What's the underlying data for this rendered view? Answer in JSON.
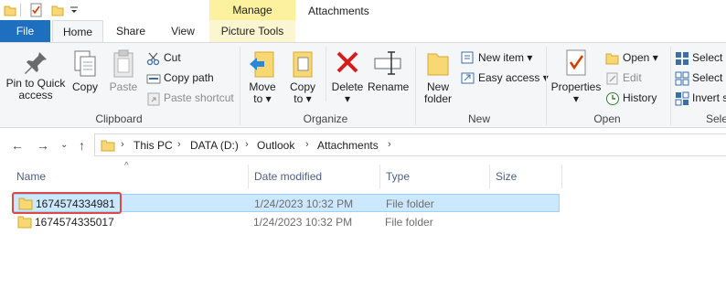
{
  "window": {
    "title": "Attachments",
    "context_tab": "Manage"
  },
  "tabs": [
    {
      "label": "File"
    },
    {
      "label": "Home"
    },
    {
      "label": "Share"
    },
    {
      "label": "View"
    },
    {
      "label": "Picture Tools"
    }
  ],
  "ribbon": {
    "clipboard": {
      "label": "Clipboard",
      "pin": "Pin to Quick\naccess",
      "pin_line1": "Pin to Quick",
      "pin_line2": "access",
      "copy": "Copy",
      "paste": "Paste",
      "cut": "Cut",
      "copy_path": "Copy path",
      "paste_shortcut": "Paste shortcut"
    },
    "organize": {
      "label": "Organize",
      "move_line1": "Move",
      "move_line2": "to",
      "copy_line1": "Copy",
      "copy_line2": "to",
      "delete": "Delete",
      "rename": "Rename"
    },
    "new": {
      "label": "New",
      "folder_line1": "New",
      "folder_line2": "folder",
      "new_item": "New item",
      "easy_access": "Easy access"
    },
    "open": {
      "label": "Open",
      "properties": "Properties",
      "open": "Open",
      "edit": "Edit",
      "history": "History"
    },
    "select": {
      "label": "Sele",
      "select_all": "Select a",
      "select_none": "Select n",
      "invert": "Invert s"
    }
  },
  "address": {
    "crumbs": [
      "This PC",
      "DATA (D:)",
      "Outlook",
      "Attachments"
    ]
  },
  "columns": {
    "name": "Name",
    "date": "Date modified",
    "type": "Type",
    "size": "Size"
  },
  "files": [
    {
      "name": "1674574334981",
      "date": "1/24/2023 10:32 PM",
      "type": "File folder",
      "size": "",
      "selected": true
    },
    {
      "name": "1674574335017",
      "date": "1/24/2023 10:32 PM",
      "type": "File folder",
      "size": "",
      "selected": false
    }
  ],
  "colors": {
    "file_tab": "#1f6fc0",
    "manage_tab": "#fbf19e",
    "selection": "#cce8ff",
    "highlight_box": "#e04848"
  }
}
